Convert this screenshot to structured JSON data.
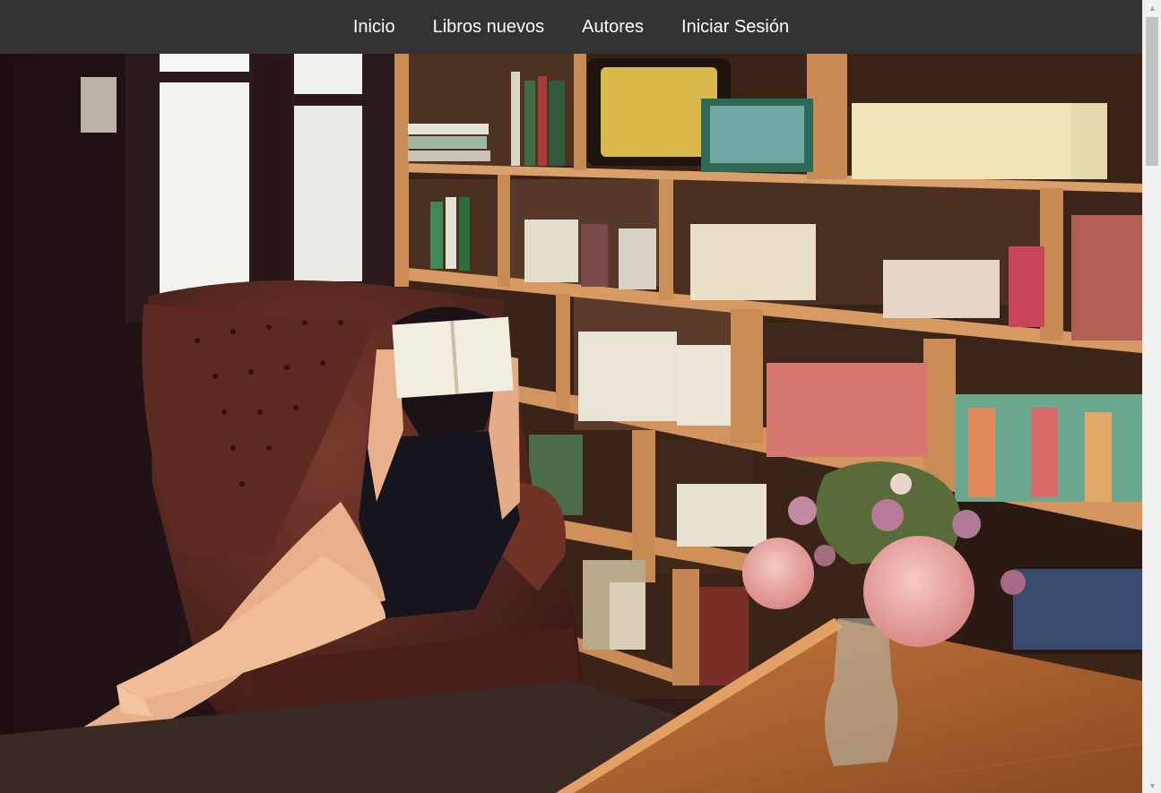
{
  "nav": {
    "items": [
      {
        "label": "Inicio"
      },
      {
        "label": "Libros nuevos"
      },
      {
        "label": "Autores"
      },
      {
        "label": "Iniciar Sesión"
      }
    ]
  },
  "hero": {
    "image_icon": "hero-photo-reading-room"
  },
  "colors": {
    "navbar_bg": "#333333",
    "nav_text": "#ffffff"
  }
}
